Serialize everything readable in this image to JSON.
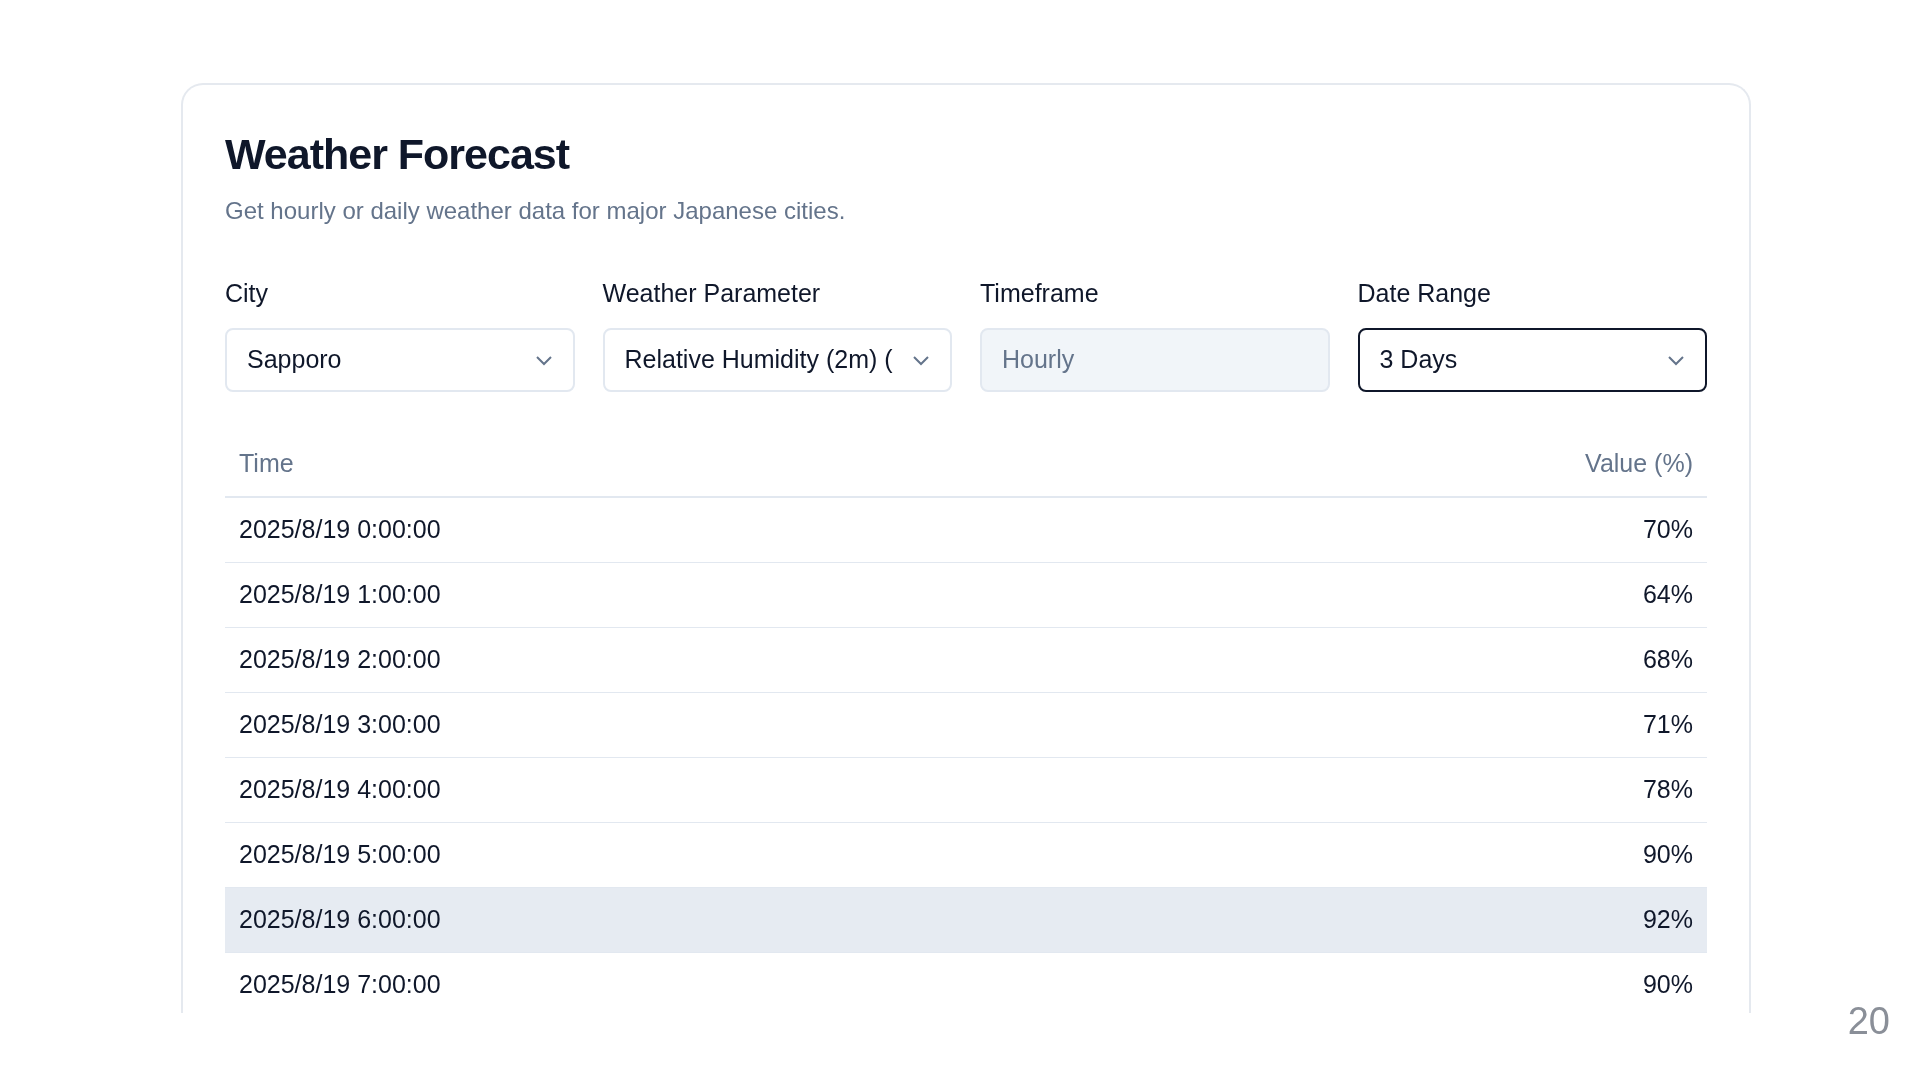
{
  "title": "Weather Forecast",
  "subtitle": "Get hourly or daily weather data for major Japanese cities.",
  "fields": [
    {
      "label": "City",
      "value": "Sapporo",
      "kind": "select",
      "disabled": false,
      "focused": false
    },
    {
      "label": "Weather Parameter",
      "value": "Relative Humidity (2m) (",
      "kind": "select",
      "disabled": false,
      "focused": false
    },
    {
      "label": "Timeframe",
      "value": "Hourly",
      "kind": "text",
      "disabled": true,
      "focused": false
    },
    {
      "label": "Date Range",
      "value": "3 Days",
      "kind": "select",
      "disabled": false,
      "focused": true
    }
  ],
  "table": {
    "columns": [
      "Time",
      "Value (%)"
    ],
    "rows": [
      {
        "time": "2025/8/19 0:00:00",
        "value": "70%",
        "selected": false
      },
      {
        "time": "2025/8/19 1:00:00",
        "value": "64%",
        "selected": false
      },
      {
        "time": "2025/8/19 2:00:00",
        "value": "68%",
        "selected": false
      },
      {
        "time": "2025/8/19 3:00:00",
        "value": "71%",
        "selected": false
      },
      {
        "time": "2025/8/19 4:00:00",
        "value": "78%",
        "selected": false
      },
      {
        "time": "2025/8/19 5:00:00",
        "value": "90%",
        "selected": false
      },
      {
        "time": "2025/8/19 6:00:00",
        "value": "92%",
        "selected": true
      },
      {
        "time": "2025/8/19 7:00:00",
        "value": "90%",
        "selected": false
      }
    ]
  },
  "page_number": "20"
}
